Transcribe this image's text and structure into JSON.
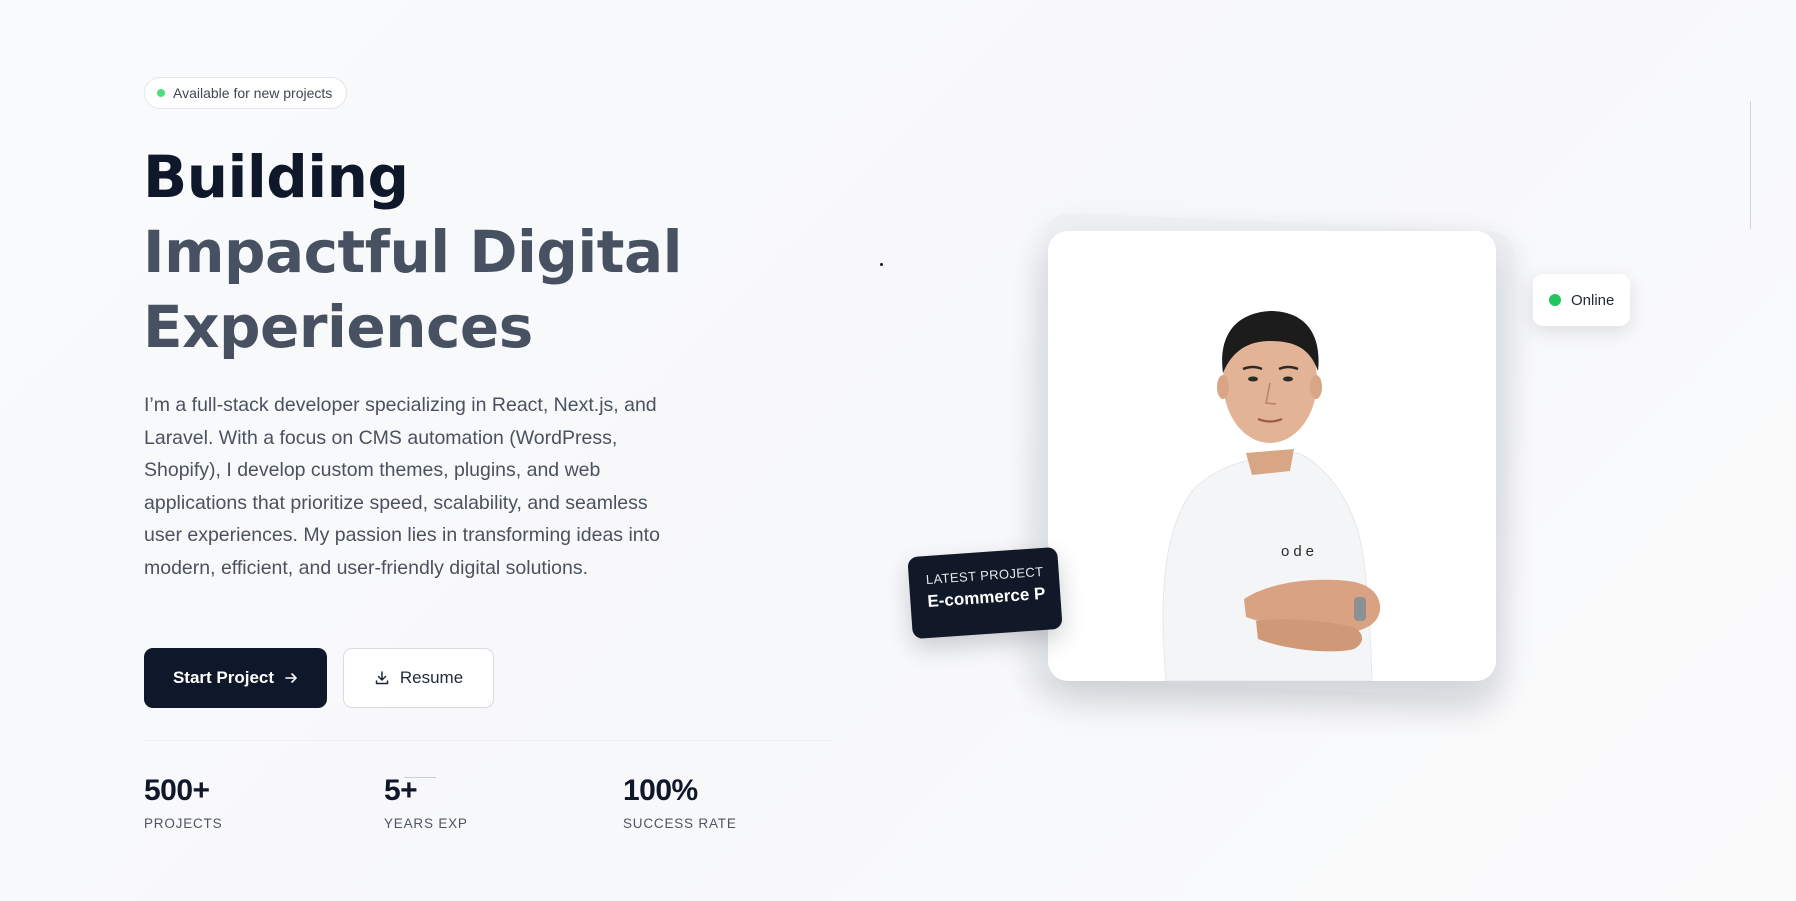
{
  "availability": {
    "label": "Available for new projects",
    "dot_color": "#4ade80"
  },
  "headline": {
    "line1": "Building",
    "line2": "Impactful Digital",
    "line3": "Experiences"
  },
  "bio": "I’m a full-stack developer specializing in React, Next.js, and Laravel. With a focus on CMS automation (WordPress, Shopify), I develop custom themes, plugins, and web applications that prioritize speed, scalability, and seamless user experiences. My passion lies in transforming ideas into modern, efficient, and user-friendly digital solutions.",
  "actions": {
    "primary_label": "Start Project",
    "primary_icon": "arrow-right-icon",
    "secondary_label": "Resume",
    "secondary_icon": "download-icon"
  },
  "stats": [
    {
      "value": "500+",
      "label": "PROJECTS"
    },
    {
      "value": "5+",
      "label": "YEARS EXP"
    },
    {
      "value": "100%",
      "label": "SUCCESS RATE"
    }
  ],
  "latest_project": {
    "kicker": "LATEST PROJECT",
    "title": "E-commerce P"
  },
  "status": {
    "label": "Online",
    "dot_color": "#22c55e"
  },
  "colors": {
    "primary": "#0f172a",
    "heading_secondary": "#475162",
    "body_text": "#4a5260"
  }
}
